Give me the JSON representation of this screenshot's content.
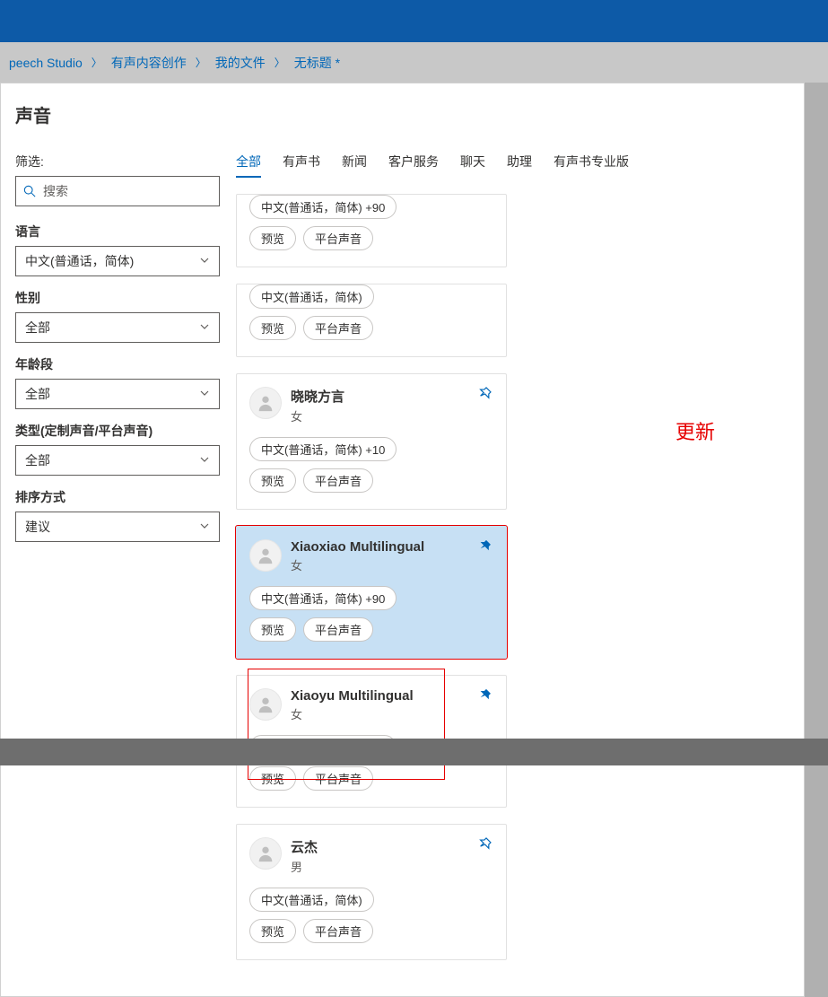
{
  "breadcrumb": {
    "items": [
      "peech Studio",
      "有声内容创作",
      "我的文件",
      "无标题 *"
    ]
  },
  "panel": {
    "title": "声音",
    "filter_label": "筛选:"
  },
  "search": {
    "placeholder": "搜索"
  },
  "filters": {
    "language": {
      "label": "语言",
      "value": "中文(普通话，简体)"
    },
    "gender": {
      "label": "性别",
      "value": "全部"
    },
    "age": {
      "label": "年龄段",
      "value": "全部"
    },
    "type": {
      "label": "类型(定制声音/平台声音)",
      "value": "全部"
    },
    "sort": {
      "label": "排序方式",
      "value": "建议"
    }
  },
  "tabs": [
    "全部",
    "有声书",
    "新闻",
    "客户服务",
    "聊天",
    "助理",
    "有声书专业版"
  ],
  "chips": {
    "lang90": "中文(普通话，简体) +90",
    "lang10": "中文(普通话，简体) +10",
    "lang": "中文(普通话，简体)",
    "preview": "预览",
    "platform": "平台声音"
  },
  "voices": {
    "v1": {
      "name": "晓晓方言",
      "gender": "女"
    },
    "v2": {
      "name": "Xiaoxiao Multilingual",
      "gender": "女"
    },
    "v3": {
      "name": "Xiaoyu Multilingual",
      "gender": "女"
    },
    "v4": {
      "name": "云杰",
      "gender": "男"
    }
  },
  "update_label": "更新"
}
